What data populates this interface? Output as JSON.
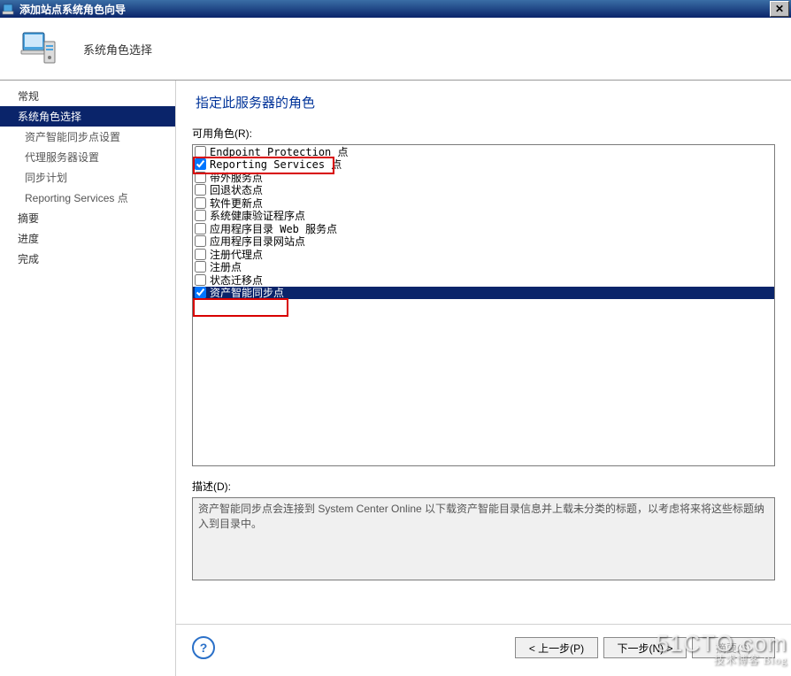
{
  "titlebar": {
    "title": "添加站点系统角色向导"
  },
  "header": {
    "subtitle": "系统角色选择"
  },
  "sidebar": {
    "items": [
      {
        "label": "常规",
        "selected": false,
        "sub": false
      },
      {
        "label": "系统角色选择",
        "selected": true,
        "sub": false
      },
      {
        "label": "资产智能同步点设置",
        "selected": false,
        "sub": true
      },
      {
        "label": "代理服务器设置",
        "selected": false,
        "sub": true
      },
      {
        "label": "同步计划",
        "selected": false,
        "sub": true
      },
      {
        "label": "Reporting Services 点",
        "selected": false,
        "sub": true
      },
      {
        "label": "摘要",
        "selected": false,
        "sub": false
      },
      {
        "label": "进度",
        "selected": false,
        "sub": false
      },
      {
        "label": "完成",
        "selected": false,
        "sub": false
      }
    ]
  },
  "main": {
    "heading": "指定此服务器的角色",
    "roles_label": "可用角色(R):",
    "roles": [
      {
        "label": "Endpoint Protection 点",
        "checked": false,
        "selected": false
      },
      {
        "label": "Reporting Services 点",
        "checked": true,
        "selected": false
      },
      {
        "label": "带外服务点",
        "checked": false,
        "selected": false
      },
      {
        "label": "回退状态点",
        "checked": false,
        "selected": false
      },
      {
        "label": "软件更新点",
        "checked": false,
        "selected": false
      },
      {
        "label": "系统健康验证程序点",
        "checked": false,
        "selected": false
      },
      {
        "label": "应用程序目录 Web 服务点",
        "checked": false,
        "selected": false
      },
      {
        "label": "应用程序目录网站点",
        "checked": false,
        "selected": false
      },
      {
        "label": "注册代理点",
        "checked": false,
        "selected": false
      },
      {
        "label": "注册点",
        "checked": false,
        "selected": false
      },
      {
        "label": "状态迁移点",
        "checked": false,
        "selected": false
      },
      {
        "label": "资产智能同步点",
        "checked": true,
        "selected": true
      }
    ],
    "desc_label": "描述(D):",
    "desc_text": "资产智能同步点会连接到 System Center Online 以下载资产智能目录信息并上载未分类的标题，以考虑将来将这些标题纳入到目录中。"
  },
  "footer": {
    "prev": "< 上一步(P)",
    "next": "下一步(N) >",
    "summary": "摘要(S)"
  },
  "watermark": {
    "line1": "51CTO.com",
    "line2": "技术博客  Blog"
  }
}
